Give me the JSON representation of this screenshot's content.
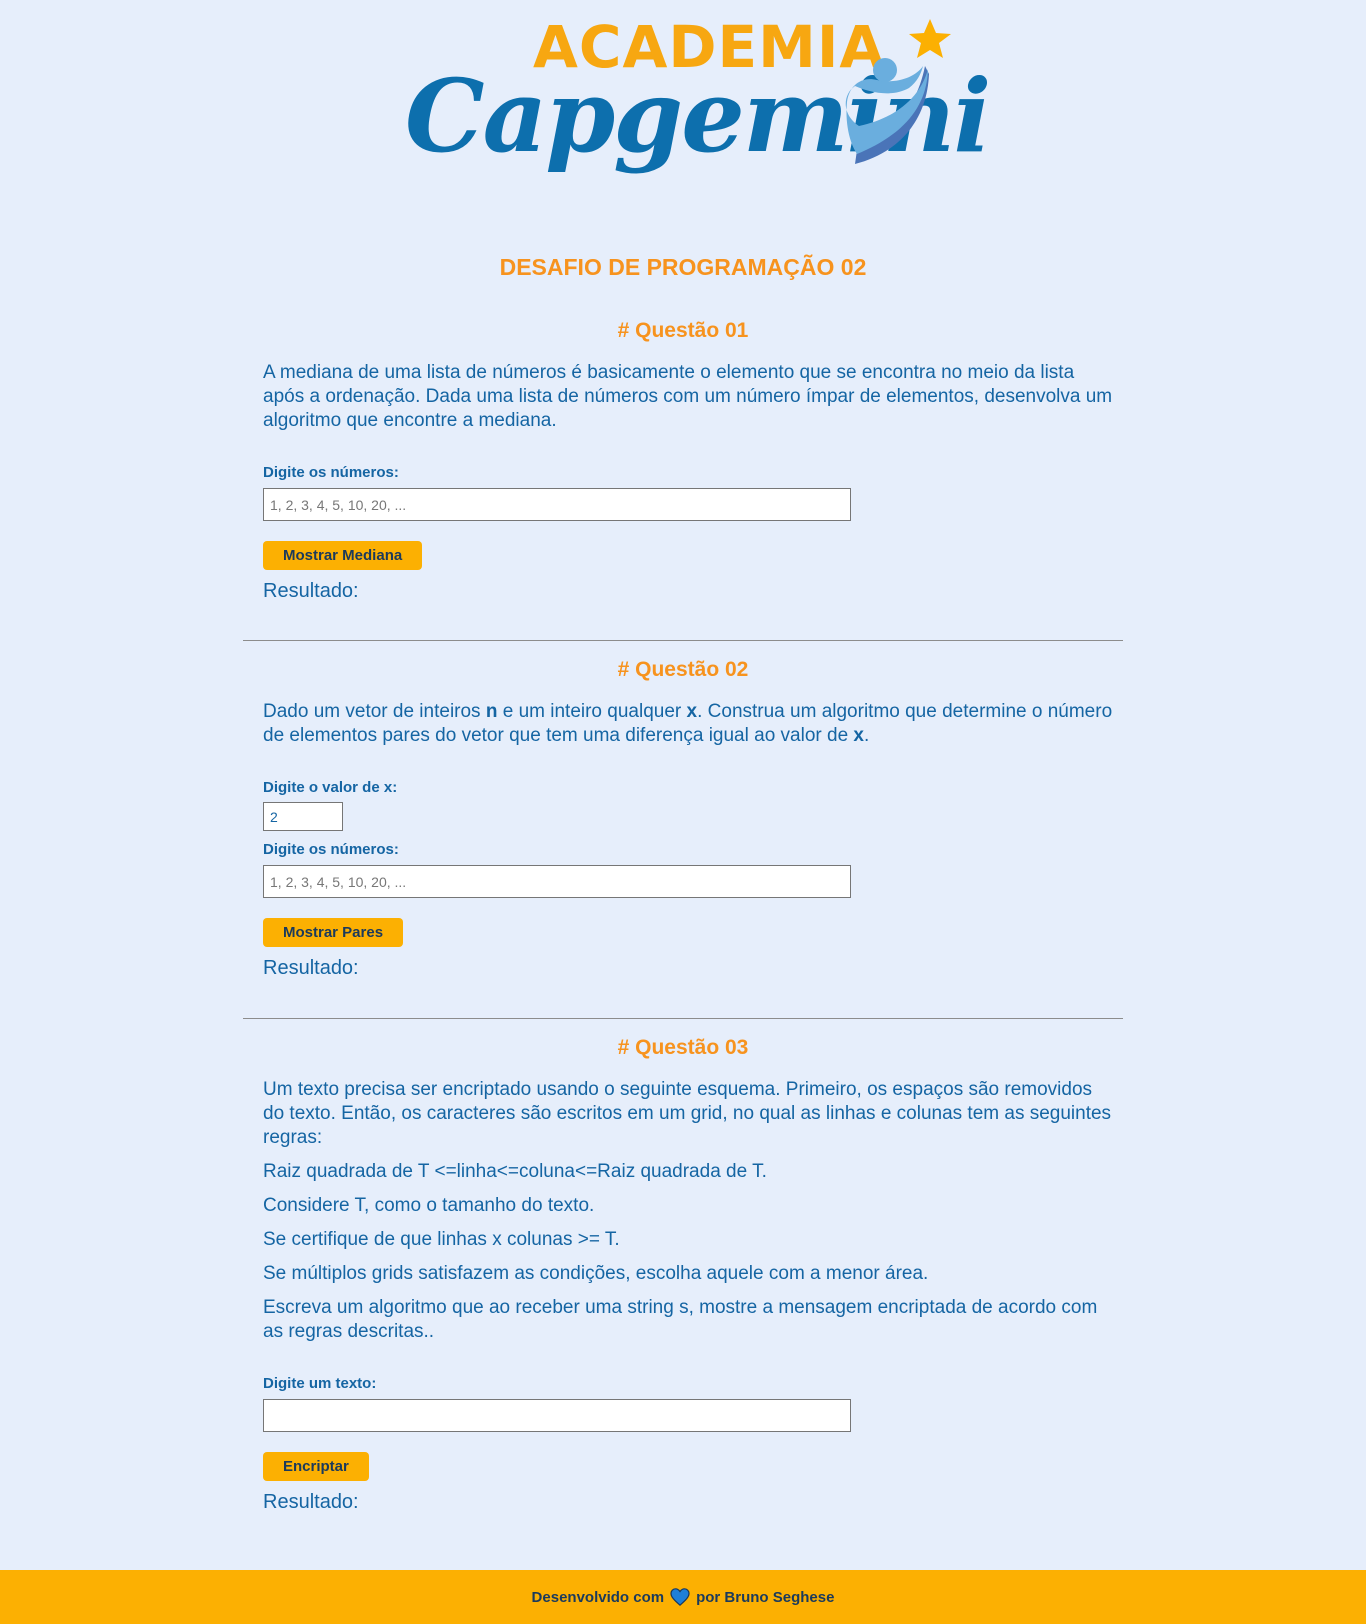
{
  "brand": {
    "line1": "ACADEMIA",
    "line2": "Capgemini",
    "colors": {
      "accent": "#f7a711",
      "primary": "#0d6fad",
      "figure_light": "#6aaede",
      "figure_dark": "#4a74b8"
    }
  },
  "page_title": "DESAFIO DE PROGRAMAÇÃO 02",
  "questions": [
    {
      "title": "# Questão 01",
      "paragraphs": [
        "A mediana de uma lista de números é basicamente o elemento que se encontra no meio da lista após a ordenação. Dada uma lista de números com um número ímpar de elementos, desenvolva um algoritmo que encontre a mediana."
      ],
      "numbers_label": "Digite os números:",
      "numbers_placeholder": "1, 2, 3, 4, 5, 10, 20, ...",
      "numbers_value": "",
      "button_label": "Mostrar Mediana",
      "result_label": "Resultado:"
    },
    {
      "title": "# Questão 02",
      "text_parts": [
        "Dado um vetor de inteiros ",
        "n",
        " e um inteiro qualquer ",
        "x",
        ". Construa um algoritmo que determine o número de elementos pares do vetor que tem uma diferença igual ao valor de ",
        "x",
        "."
      ],
      "x_label": "Digite o valor de x:",
      "x_value": "2",
      "numbers_label": "Digite os números:",
      "numbers_placeholder": "1, 2, 3, 4, 5, 10, 20, ...",
      "numbers_value": "",
      "button_label": "Mostrar Pares",
      "result_label": "Resultado:"
    },
    {
      "title": "# Questão 03",
      "paragraphs": [
        "Um texto precisa ser encriptado usando o seguinte esquema. Primeiro, os espaços são removidos do texto. Então, os caracteres são escritos em um grid, no qual as linhas e colunas tem as seguintes regras:",
        "Raiz quadrada de T <=linha<=coluna<=Raiz quadrada de T.",
        "Considere T, como o tamanho do texto.",
        "Se certifique de que linhas x colunas >= T.",
        "Se múltiplos grids satisfazem as condições, escolha aquele com a menor área.",
        "Escreva um algoritmo que ao receber uma string s, mostre a mensagem encriptada de acordo com as regras descritas.."
      ],
      "text_label": "Digite um texto:",
      "text_value": "",
      "button_label": "Encriptar",
      "result_label": "Resultado:"
    }
  ],
  "footer": {
    "before": "Desenvolvido com",
    "icon": "heart-icon",
    "after": "por Bruno Seghese",
    "background": "#fcb002"
  }
}
